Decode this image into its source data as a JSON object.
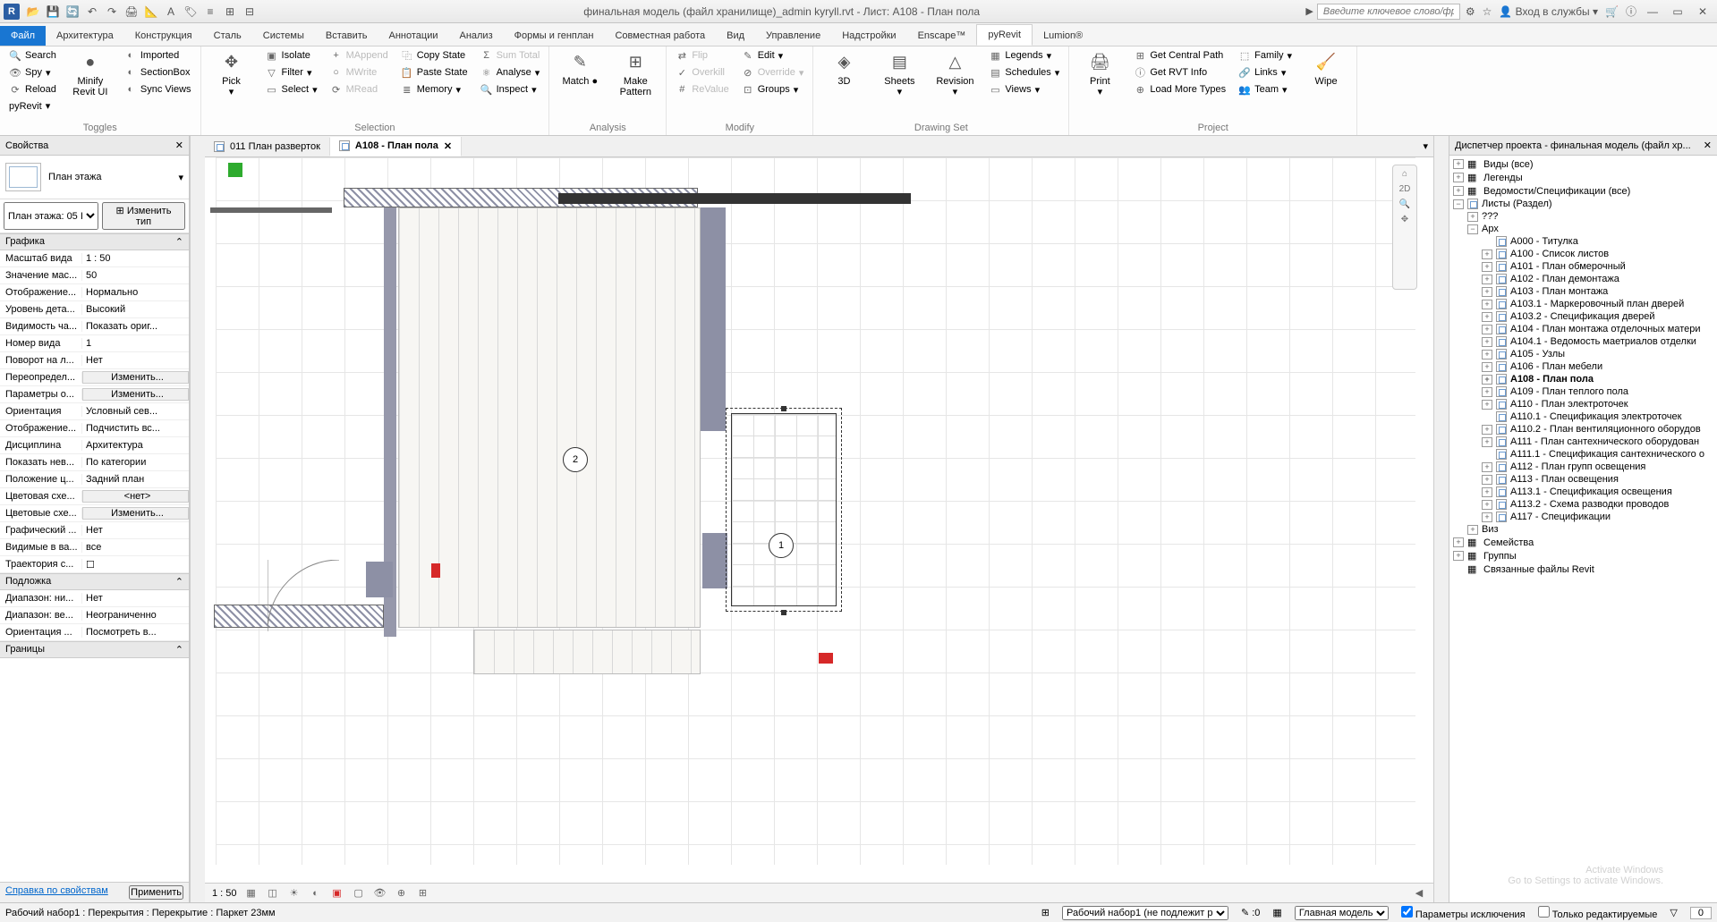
{
  "title": "финальная модель (файл хранилище)_admin kyryll.rvt - Лист: A108 - План пола",
  "search_placeholder": "Введите ключевое слово/фразу",
  "signin": "Вход в службы",
  "ribbon_tabs": [
    "Файл",
    "Архитектура",
    "Конструкция",
    "Сталь",
    "Системы",
    "Вставить",
    "Аннотации",
    "Анализ",
    "Формы и генплан",
    "Совместная работа",
    "Вид",
    "Управление",
    "Надстройки",
    "Enscape™",
    "pyRevit",
    "Lumion®"
  ],
  "ribbon": {
    "toggles": {
      "search": "Search",
      "spy": "Spy",
      "reload": "Reload",
      "pyrevit": "pyRevit",
      "imported": "Imported",
      "sectionbox": "SectionBox",
      "syncviews": "Sync Views",
      "minify": "Minify Revit UI",
      "label": "Toggles"
    },
    "selection": {
      "pick": "Pick",
      "isolate": "Isolate",
      "filter": "Filter",
      "select": "Select",
      "mappend": "MAppend",
      "mwrite": "MWrite",
      "mread": "MRead",
      "copystate": "Copy State",
      "pastestate": "Paste State",
      "memory": "Memory",
      "sumtotal": "Sum Total",
      "analyse": "Analyse",
      "inspect": "Inspect",
      "label": "Selection"
    },
    "analysis": {
      "match": "Match",
      "make": "Make Pattern",
      "label": "Analysis"
    },
    "modify": {
      "flip": "Flip",
      "overkill": "Overkill",
      "revalue": "ReValue",
      "edit": "Edit",
      "override": "Override",
      "groups": "Groups",
      "label": "Modify"
    },
    "drawingset": {
      "3d": "3D",
      "sheets": "Sheets",
      "revision": "Revision",
      "legends": "Legends",
      "schedules": "Schedules",
      "views": "Views",
      "label": "Drawing Set"
    },
    "project": {
      "print": "Print",
      "getcentral": "Get Central Path",
      "getrvt": "Get RVT Info",
      "loadmore": "Load More Types",
      "family": "Family",
      "links": "Links",
      "team": "Team",
      "wipe": "Wipe",
      "label": "Project"
    }
  },
  "properties": {
    "title": "Свойства",
    "type": "План этажа",
    "instance": "План этажа: 05 I",
    "edit_type": "Изменить тип",
    "group_graphics": "Графика",
    "rows": [
      {
        "k": "Масштаб вида",
        "v": "1 : 50"
      },
      {
        "k": "Значение мас...",
        "v": "50"
      },
      {
        "k": "Отображение...",
        "v": "Нормально"
      },
      {
        "k": "Уровень дета...",
        "v": "Высокий"
      },
      {
        "k": "Видимость ча...",
        "v": "Показать ориг..."
      },
      {
        "k": "Номер вида",
        "v": "1"
      },
      {
        "k": "Поворот на л...",
        "v": "Нет"
      },
      {
        "k": "Переопредел...",
        "v": "Изменить...",
        "btn": true
      },
      {
        "k": "Параметры о...",
        "v": "Изменить...",
        "btn": true
      },
      {
        "k": "Ориентация",
        "v": "Условный сев..."
      },
      {
        "k": "Отображение...",
        "v": "Подчистить вс..."
      },
      {
        "k": "Дисциплина",
        "v": "Архитектура"
      },
      {
        "k": "Показать нев...",
        "v": "По категории"
      },
      {
        "k": "Положение ц...",
        "v": "Задний план"
      },
      {
        "k": "Цветовая схе...",
        "v": "<нет>",
        "btn": true
      },
      {
        "k": "Цветовые схе...",
        "v": "Изменить...",
        "btn": true
      },
      {
        "k": "Графический ...",
        "v": "Нет"
      },
      {
        "k": "Видимые в ва...",
        "v": "все"
      },
      {
        "k": "Траектория с...",
        "v": "☐"
      }
    ],
    "group_underlay": "Подложка",
    "rows2": [
      {
        "k": "Диапазон: ни...",
        "v": "Нет"
      },
      {
        "k": "Диапазон: ве...",
        "v": "Неограниченно"
      },
      {
        "k": "Ориентация ...",
        "v": "Посмотреть в..."
      }
    ],
    "group_bounds": "Границы",
    "help": "Справка по свойствам",
    "apply": "Применить"
  },
  "tabs": {
    "t1": "011 План разверток",
    "t2": "A108 - План пола"
  },
  "rooms": {
    "r1": "1",
    "r2": "2"
  },
  "view_scale": "1 : 50",
  "browser": {
    "title": "Диспетчер проекта - финальная модель (файл хр...",
    "nodes": [
      {
        "l": "Виды (все)",
        "ind": 0,
        "tw": "+",
        "ico": "v"
      },
      {
        "l": "Легенды",
        "ind": 0,
        "tw": "+",
        "ico": "l"
      },
      {
        "l": "Ведомости/Спецификации (все)",
        "ind": 0,
        "tw": "+",
        "ico": "s"
      },
      {
        "l": "Листы (Раздел)",
        "ind": 0,
        "tw": "−",
        "ico": "sh"
      },
      {
        "l": "???",
        "ind": 1,
        "tw": "+"
      },
      {
        "l": "Арх",
        "ind": 1,
        "tw": "−"
      },
      {
        "l": "А000 - Титулка",
        "ind": 2
      },
      {
        "l": "А100 - Список листов",
        "ind": 2,
        "tw": "+"
      },
      {
        "l": "А101 - План обмерочный",
        "ind": 2,
        "tw": "+"
      },
      {
        "l": "А102 - План демонтажа",
        "ind": 2,
        "tw": "+"
      },
      {
        "l": "А103 - План монтажа",
        "ind": 2,
        "tw": "+"
      },
      {
        "l": "А103.1 - Маркеровочный план дверей",
        "ind": 2,
        "tw": "+"
      },
      {
        "l": "А103.2 - Спецификация дверей",
        "ind": 2,
        "tw": "+"
      },
      {
        "l": "А104 - План монтажа отделочных матери",
        "ind": 2,
        "tw": "+"
      },
      {
        "l": "А104.1 - Ведомость маетриалов отделки",
        "ind": 2,
        "tw": "+"
      },
      {
        "l": "А105 - Узлы",
        "ind": 2,
        "tw": "+"
      },
      {
        "l": "А106 - План мебели",
        "ind": 2,
        "tw": "+"
      },
      {
        "l": "А108 - План пола",
        "ind": 2,
        "tw": "+",
        "sel": true
      },
      {
        "l": "А109 - План теплого пола",
        "ind": 2,
        "tw": "+"
      },
      {
        "l": "А110 - План электроточек",
        "ind": 2,
        "tw": "+"
      },
      {
        "l": "А110.1 - Спецификация электроточек",
        "ind": 2
      },
      {
        "l": "А110.2 - План вентиляционного оборудов",
        "ind": 2,
        "tw": "+"
      },
      {
        "l": "А111 - План сантехнического оборудован",
        "ind": 2,
        "tw": "+"
      },
      {
        "l": "А111.1 - Спецификация сантехнического о",
        "ind": 2
      },
      {
        "l": "А112 - План групп освещения",
        "ind": 2,
        "tw": "+"
      },
      {
        "l": "А113 - План освещения",
        "ind": 2,
        "tw": "+"
      },
      {
        "l": "А113.1 - Спецификация освещения",
        "ind": 2,
        "tw": "+"
      },
      {
        "l": "А113.2 - Схема разводки проводов",
        "ind": 2,
        "tw": "+"
      },
      {
        "l": "А117 - Спецификации",
        "ind": 2,
        "tw": "+"
      },
      {
        "l": "Виз",
        "ind": 1,
        "tw": "+"
      },
      {
        "l": "Семейства",
        "ind": 0,
        "tw": "+",
        "ico": "f"
      },
      {
        "l": "Группы",
        "ind": 0,
        "tw": "+",
        "ico": "g"
      },
      {
        "l": "Связанные файлы Revit",
        "ind": 0,
        "ico": "r"
      }
    ]
  },
  "status": {
    "left": "Рабочий набор1 : Перекрытия : Перекрытие : Паркет 23мм",
    "workset": "Рабочий набор1 (не подлежит р",
    "model": "Главная модель",
    "excl": "Параметры исключения",
    "editable": "Только редактируемые",
    "sel": "0"
  },
  "watermark": {
    "l1": "Activate Windows",
    "l2": "Go to Settings to activate Windows."
  }
}
